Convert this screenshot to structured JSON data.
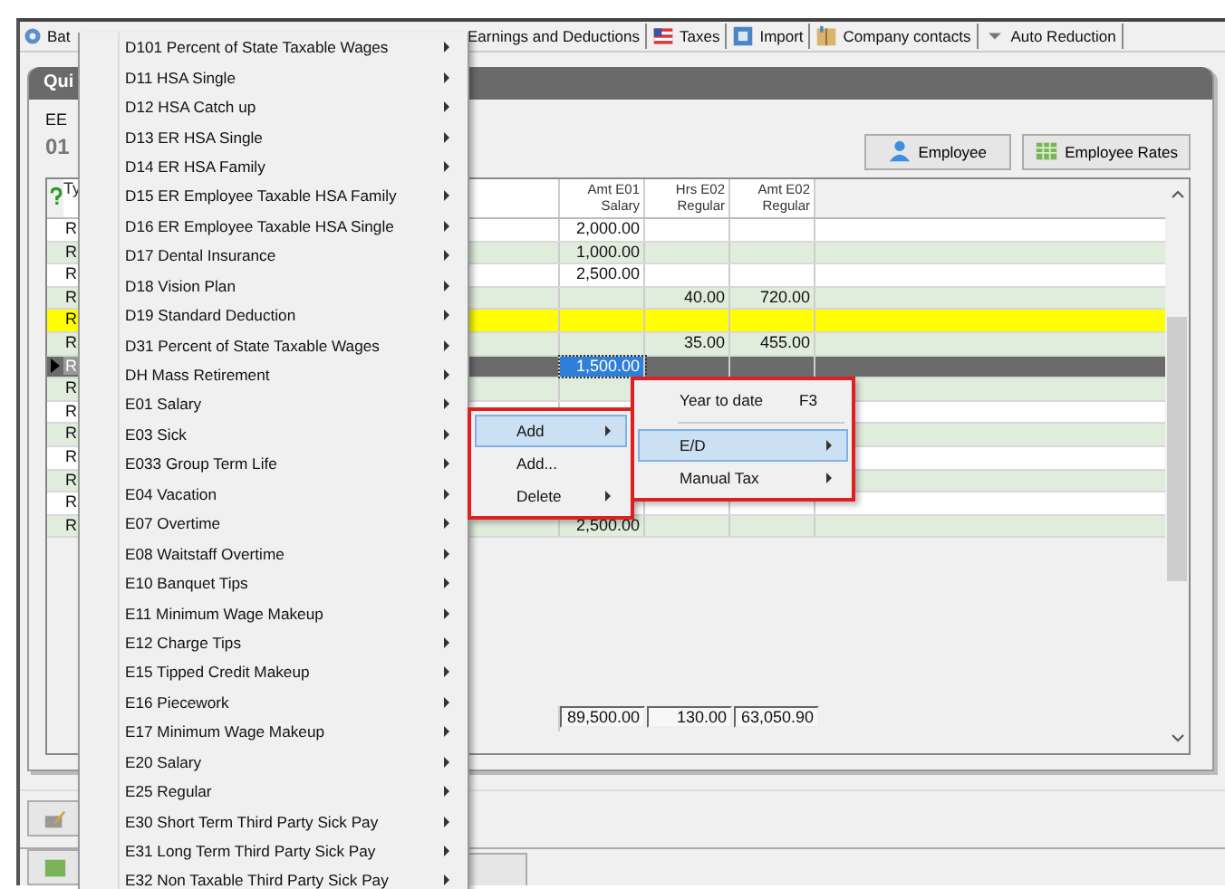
{
  "toolbar": [
    {
      "label": "Bat",
      "kind": "batch"
    },
    {
      "label": "Earnings and Deductions",
      "kind": "plain"
    },
    {
      "label": "Taxes",
      "kind": "flag"
    },
    {
      "label": "Import",
      "kind": "import"
    },
    {
      "label": "Company contacts",
      "kind": "book"
    },
    {
      "label": "Auto Reduction",
      "kind": "filter"
    }
  ],
  "panel": {
    "title": "Qui",
    "ee_label": "EE",
    "ee_value": "01",
    "buttons": [
      {
        "label": "Employee",
        "kind": "person"
      },
      {
        "label": "Employee Rates",
        "kind": "rates"
      }
    ]
  },
  "grid": {
    "type_heading": "Ty",
    "columns": [
      {
        "name": "Amt E01",
        "sub": "Salary"
      },
      {
        "name": "Hrs E02",
        "sub": "Regular"
      },
      {
        "name": "Amt E02",
        "sub": "Regular"
      }
    ],
    "rows": [
      {
        "type": "R",
        "cells": [
          "2,000.00",
          "",
          ""
        ],
        "flagged": false,
        "selected": false
      },
      {
        "type": "R",
        "cells": [
          "1,000.00",
          "",
          ""
        ],
        "flagged": false,
        "selected": false
      },
      {
        "type": "R",
        "cells": [
          "2,500.00",
          "",
          ""
        ],
        "flagged": false,
        "selected": false
      },
      {
        "type": "R",
        "cells": [
          "",
          "40.00",
          "720.00"
        ],
        "flagged": false,
        "selected": false
      },
      {
        "type": "R",
        "cells": [
          "",
          "",
          ""
        ],
        "flagged": true,
        "selected": false
      },
      {
        "type": "R",
        "cells": [
          "",
          "35.00",
          "455.00"
        ],
        "flagged": false,
        "selected": false
      },
      {
        "type": "R",
        "cells": [
          "1,500.00",
          "",
          ""
        ],
        "flagged": false,
        "selected": true
      },
      {
        "type": "R",
        "cells": [
          "",
          "",
          ""
        ],
        "flagged": false,
        "selected": false
      },
      {
        "type": "R",
        "cells": [
          "",
          "",
          ""
        ],
        "flagged": false,
        "selected": false
      },
      {
        "type": "R",
        "cells": [
          "",
          "",
          ""
        ],
        "flagged": false,
        "selected": false
      },
      {
        "type": "R",
        "cells": [
          "",
          "",
          ""
        ],
        "flagged": false,
        "selected": false
      },
      {
        "type": "R",
        "cells": [
          "",
          "",
          ""
        ],
        "flagged": false,
        "selected": false
      },
      {
        "type": "R",
        "cells": [
          "",
          "",
          ""
        ],
        "flagged": false,
        "selected": false
      },
      {
        "type": "R",
        "cells": [
          "2,500.00",
          "",
          ""
        ],
        "flagged": false,
        "selected": false
      }
    ],
    "totals": [
      "89,500.00",
      "130.00",
      "63,050.90"
    ]
  },
  "ed_menu": [
    "D101 Percent of State Taxable Wages",
    "D11 HSA Single",
    "D12 HSA Catch up",
    "D13 ER HSA Single",
    "D14 ER HSA Family",
    "D15 ER Employee Taxable HSA Family",
    "D16 ER Employee Taxable HSA Single",
    "D17 Dental Insurance",
    "D18 Vision Plan",
    "D19 Standard Deduction",
    "D31 Percent of State Taxable Wages",
    "DH Mass Retirement",
    "E01 Salary",
    "E03 Sick",
    "E033 Group Term Life",
    "E04 Vacation",
    "E07 Overtime",
    "E08 Waitstaff Overtime",
    "E10 Banquet Tips",
    "E11 Minimum Wage Makeup",
    "E12 Charge Tips",
    "E15 Tipped Credit Makeup",
    "E16 Piecework",
    "E17 Minimum Wage Makeup",
    "E20 Salary",
    "E25 Regular",
    "E30 Short Term Third Party Sick Pay",
    "E31 Long Term Third Party Sick Pay",
    "E32 Non Taxable Third Party Sick Pay"
  ],
  "context_menu": [
    {
      "label": "Add",
      "submenu": true,
      "selected": true
    },
    {
      "label": "Add...",
      "submenu": false,
      "selected": false
    },
    {
      "label": "Delete",
      "submenu": true,
      "selected": false
    }
  ],
  "add_menu": [
    {
      "label": "Year to date",
      "shortcut": "F3",
      "submenu": false,
      "selected": false,
      "separator_after": true
    },
    {
      "label": "E/D",
      "submenu": true,
      "selected": true,
      "separator_after": false
    },
    {
      "label": "Manual Tax",
      "submenu": true,
      "selected": false,
      "separator_after": false
    }
  ]
}
